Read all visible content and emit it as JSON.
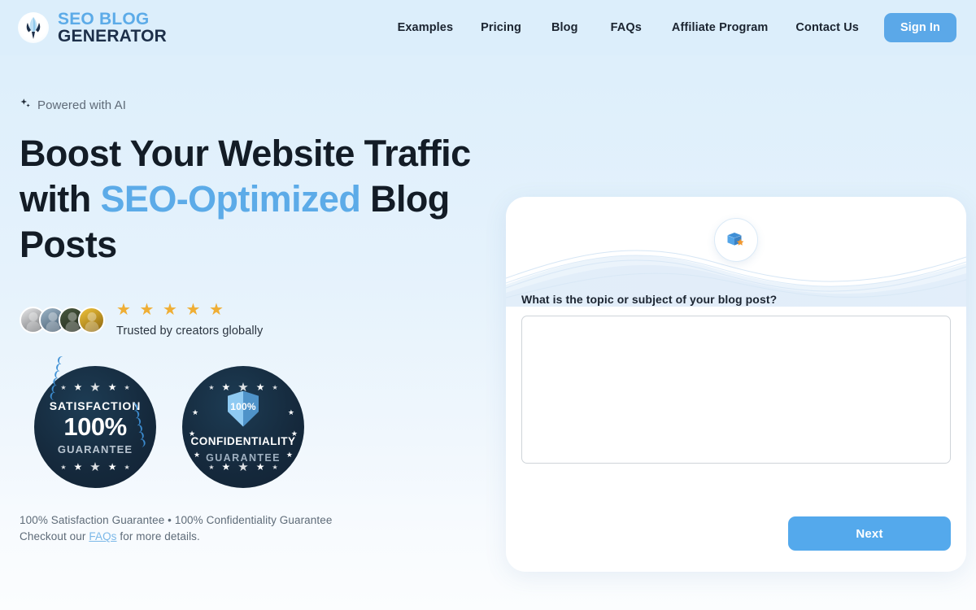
{
  "brand": {
    "line1": "SEO BLOG",
    "line2": "GENERATOR",
    "logo_icon": "quill-feather-icon"
  },
  "nav": {
    "items": [
      {
        "label": "Examples"
      },
      {
        "label": "Pricing"
      },
      {
        "label": "Blog"
      },
      {
        "label": "FAQs"
      },
      {
        "label": "Affiliate Program"
      },
      {
        "label": "Contact Us"
      }
    ],
    "signin_label": "Sign In",
    "signin_color": "#5ba8e8"
  },
  "hero": {
    "eyebrow": "Powered with AI",
    "eyebrow_icon": "sparkle-icon",
    "headline_part1": "Boost Your Website Traffic with ",
    "headline_accent": "SEO-Optimized",
    "headline_part2": " Blog Posts",
    "accent_color": "#5cabe8"
  },
  "social_proof": {
    "stars": "★ ★ ★ ★ ★",
    "star_count": 5,
    "star_color": "#efae35",
    "trusted_text": "Trusted by creators globally",
    "avatar_count": 4
  },
  "badges": [
    {
      "name": "satisfaction-guarantee-badge",
      "line1": "SATISFACTION",
      "line2": "100%",
      "line3": "GUARANTEE"
    },
    {
      "name": "confidentiality-guarantee-badge",
      "shield_text": "100%",
      "line1": "CONFIDENTIALITY",
      "line2": "GUARANTEE"
    }
  ],
  "fineprint": {
    "line1": "100% Satisfaction Guarantee • 100% Confidentiality Guarantee",
    "line2_before": "Checkout our ",
    "link_label": "FAQs",
    "line2_after": " for more details."
  },
  "form_card": {
    "icon": "box-star-icon",
    "question": "What is the topic or subject of your blog post?",
    "topic_value": "",
    "topic_placeholder": "",
    "next_label": "Next",
    "next_color": "#54a9ec"
  }
}
